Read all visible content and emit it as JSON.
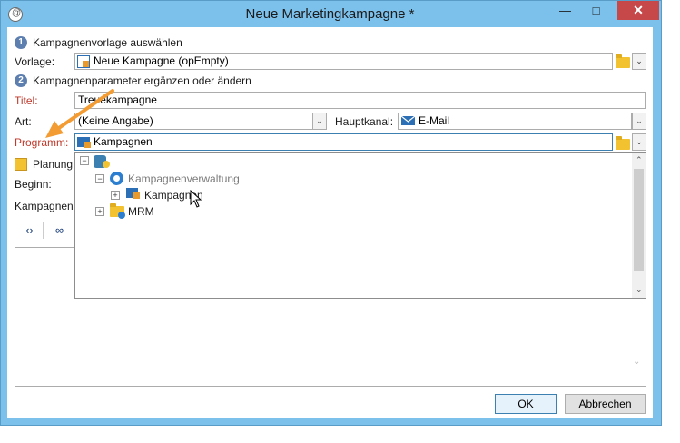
{
  "window": {
    "title": "Neue Marketingkampagne *",
    "close_glyph": "✕",
    "min_glyph": "—",
    "max_glyph": "□"
  },
  "step1": {
    "number": "1",
    "heading": "Kampagnenvorlage auswählen",
    "vorlage_label": "Vorlage:",
    "vorlage_value": "Neue Kampagne (opEmpty)"
  },
  "step2": {
    "number": "2",
    "heading": "Kampagnenparameter ergänzen oder ändern"
  },
  "fields": {
    "titel_label": "Titel:",
    "titel_value": "Treuekampagne",
    "art_label": "Art:",
    "art_value": "(Keine Angabe)",
    "hauptkanal_label": "Hauptkanal:",
    "hauptkanal_value": "E-Mail",
    "programm_label": "Programm:",
    "programm_value": "Kampagnen",
    "planung_label": "Planung",
    "beginn_label": "Beginn:",
    "kampagnen_label": "Kampagnenl"
  },
  "tree": {
    "root_label": "",
    "items": [
      {
        "label": "Kampagnenverwaltung",
        "expander": "⊟"
      },
      {
        "label": "Kampagnen",
        "expander": "⊞"
      },
      {
        "label": "MRM",
        "expander": "⊞"
      }
    ]
  },
  "buttons": {
    "ok": "OK",
    "cancel": "Abbrechen"
  },
  "colors": {
    "titlebar": "#7cc1ec",
    "close": "#c74848",
    "required_label": "#c0392b",
    "annotation_arrow": "#f39c34"
  }
}
